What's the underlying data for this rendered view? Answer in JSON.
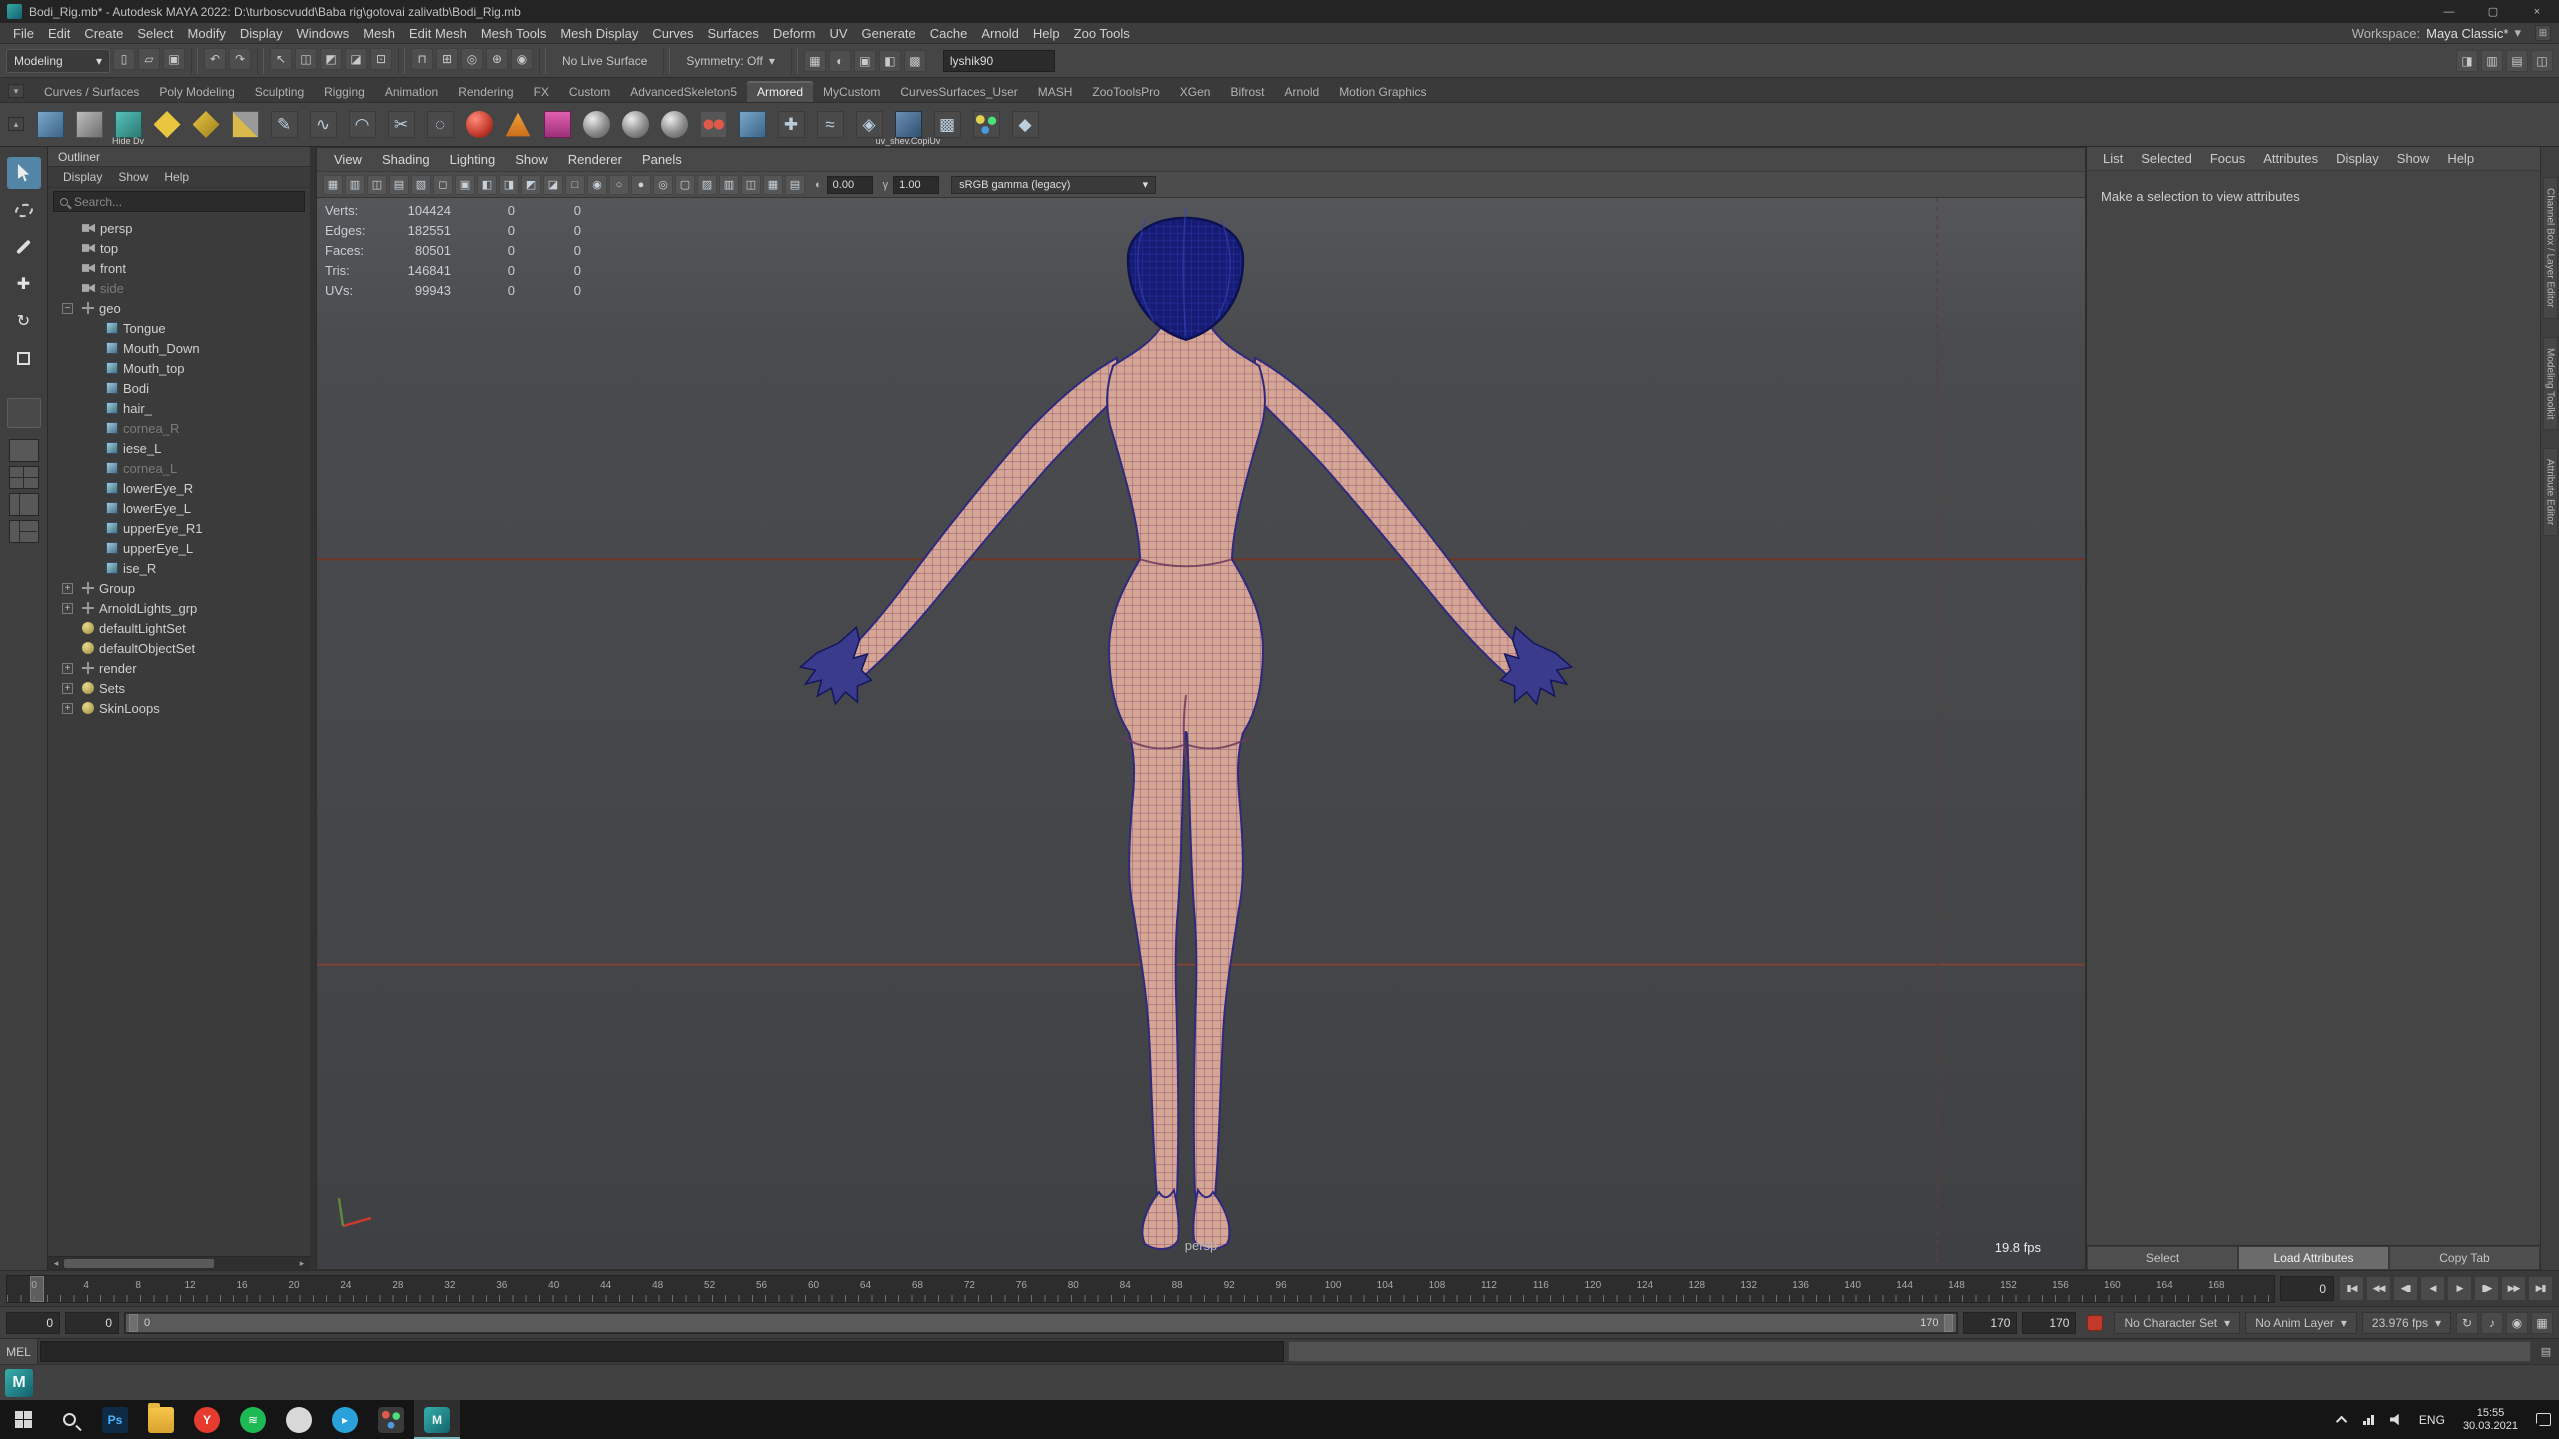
{
  "title_bar": {
    "title": "Bodi_Rig.mb* - Autodesk MAYA 2022: D:\\turboscvudd\\Baba rig\\gotovai zalivatb\\Bodi_Rig.mb",
    "minimize_glyph": "—",
    "restore_glyph": "▢",
    "close_glyph": "×"
  },
  "menu_bar": {
    "menus": [
      "File",
      "Edit",
      "Create",
      "Select",
      "Modify",
      "Display",
      "Windows",
      "Mesh",
      "Edit Mesh",
      "Mesh Tools",
      "Mesh Display",
      "Curves",
      "Surfaces",
      "Deform",
      "UV",
      "Generate",
      "Cache",
      "Arnold",
      "Help",
      "Zoo Tools"
    ],
    "workspace_label": "Workspace:",
    "workspace_value": "Maya Classic*",
    "workspace_arrow": "▾"
  },
  "status_line": {
    "mode": "Modeling",
    "mode_arrow": "▾",
    "items": [
      {
        "g": "▯"
      },
      {
        "g": "▱"
      },
      {
        "g": "▣"
      },
      {
        "cls": "divider"
      },
      {
        "g": "↶"
      },
      {
        "g": "↷"
      },
      {
        "cls": "divider"
      },
      {
        "g": "↖"
      },
      {
        "g": "◫"
      },
      {
        "g": "◩"
      },
      {
        "g": "◪"
      },
      {
        "g": "⊡"
      },
      {
        "cls": "divider"
      },
      {
        "g": "⊓"
      },
      {
        "g": "⊞"
      },
      {
        "g": "◎"
      },
      {
        "g": "⊕"
      },
      {
        "g": "◉"
      },
      {
        "cls": "divider"
      }
    ],
    "no_live_surface": "No Live Surface",
    "symmetry": "Symmetry: Off",
    "symmetry_arrow": "▾",
    "render_items": [
      {
        "g": "▦"
      },
      {
        "g": "◐"
      },
      {
        "g": "▣"
      },
      {
        "g": "◧"
      },
      {
        "g": "▩"
      }
    ],
    "input_value": "lyshik90",
    "right_items": [
      {
        "g": "◨"
      },
      {
        "g": "▥"
      },
      {
        "g": "▤"
      },
      {
        "g": "◫"
      }
    ]
  },
  "shelf_tabs": {
    "menu_glyph": "▾",
    "tabs": [
      {
        "label": "Curves / Surfaces"
      },
      {
        "label": "Poly Modeling"
      },
      {
        "label": "Sculpting"
      },
      {
        "label": "Rigging"
      },
      {
        "label": "Animation"
      },
      {
        "label": "Rendering"
      },
      {
        "label": "FX"
      },
      {
        "label": "Custom"
      },
      {
        "label": "AdvancedSkeleton5"
      },
      {
        "label": "Armored",
        "cls": "active"
      },
      {
        "label": "MyCustom"
      },
      {
        "label": "CurvesSurfaces_User"
      },
      {
        "label": "MASH"
      },
      {
        "label": "ZooToolsPro"
      },
      {
        "label": "XGen"
      },
      {
        "label": "Bifrost"
      },
      {
        "label": "Arnold"
      },
      {
        "label": "Motion Graphics"
      }
    ]
  },
  "shelf": {
    "menu_glyph": "▴",
    "items": [
      {
        "cls": "sh-cube-blue"
      },
      {
        "cls": "sh-cube-gray"
      },
      {
        "cls": "sh-cube-teal",
        "label": "Hide Dv"
      },
      {
        "cls": "sh-diamond"
      },
      {
        "cls": "sh-diamond2"
      },
      {
        "cls": "sh-cubes"
      },
      {
        "cls": "sh-glyph",
        "glyph": "✎"
      },
      {
        "cls": "sh-glyph",
        "glyph": "∿"
      },
      {
        "cls": "sh-glyph",
        "glyph": "◠"
      },
      {
        "cls": "sh-glyph",
        "glyph": "✂"
      },
      {
        "cls": "sh-glyph",
        "glyph": "◌"
      },
      {
        "cls": "sh-sphere-red"
      },
      {
        "cls": "sh-tri-orange"
      },
      {
        "cls": "sh-sq-magenta"
      },
      {
        "cls": "sh-sphere"
      },
      {
        "cls": "sh-sphere"
      },
      {
        "cls": "sh-sphere"
      },
      {
        "cls": "sh-dots-red"
      },
      {
        "cls": "sh-cube-blue"
      },
      {
        "cls": "sh-glyph",
        "glyph": "✚"
      },
      {
        "cls": "sh-glyph",
        "glyph": "≈"
      },
      {
        "cls": "sh-glyph",
        "glyph": "◈"
      },
      {
        "cls": "sh-uv",
        "label": "uv_shev.CopiUv"
      },
      {
        "cls": "sh-glyph",
        "glyph": "▩"
      },
      {
        "cls": "sh-dots-multi"
      },
      {
        "cls": "sh-glyph",
        "glyph": "◆"
      }
    ]
  },
  "toolbox": {
    "tools": [
      {
        "name": "select-tool",
        "cls": "tb-select selected"
      },
      {
        "name": "lasso-tool",
        "cls": "tb-lasso"
      },
      {
        "name": "paint-selection-tool",
        "cls": "tb-paint"
      },
      {
        "name": "move-tool",
        "cls": "tb-move",
        "glyph": "✚"
      },
      {
        "name": "rotate-tool",
        "cls": "tb-rotate",
        "glyph": "↻"
      },
      {
        "name": "scale-tool",
        "cls": "tb-scale"
      }
    ],
    "layouts": [
      {
        "name": "layout-single-pane",
        "cls": "lay-single"
      },
      {
        "name": "layout-four-pane",
        "cls": "lay-four"
      },
      {
        "name": "layout-two-pane",
        "cls": "lay-split2"
      },
      {
        "name": "layout-persp-outliner",
        "cls": "lay-split3"
      }
    ]
  },
  "outliner": {
    "title": "Outliner",
    "menus": [
      "Display",
      "Show",
      "Help"
    ],
    "search_placeholder": "Search...",
    "items": [
      {
        "label": "persp",
        "icon": "camera"
      },
      {
        "label": "top",
        "icon": "camera"
      },
      {
        "label": "front",
        "icon": "camera"
      },
      {
        "label": "side",
        "icon": "camera",
        "cls": "dimmed"
      },
      {
        "label": "geo",
        "icon": "transform",
        "expand": "−"
      },
      {
        "label": "Tongue",
        "icon": "mesh",
        "cls": "ind"
      },
      {
        "label": "Mouth_Down",
        "icon": "mesh",
        "cls": "ind"
      },
      {
        "label": "Mouth_top",
        "icon": "mesh",
        "cls": "ind"
      },
      {
        "label": "Bodi",
        "icon": "mesh",
        "cls": "ind"
      },
      {
        "label": "hair_",
        "icon": "mesh",
        "cls": "ind"
      },
      {
        "label": "cornea_R",
        "icon": "mesh",
        "cls": "ind dimmed"
      },
      {
        "label": "iese_L",
        "icon": "mesh",
        "cls": "ind"
      },
      {
        "label": "cornea_L",
        "icon": "mesh",
        "cls": "ind dimmed"
      },
      {
        "label": "lowerEye_R",
        "icon": "mesh",
        "cls": "ind"
      },
      {
        "label": "lowerEye_L",
        "icon": "mesh",
        "cls": "ind"
      },
      {
        "label": "upperEye_R1",
        "icon": "mesh",
        "cls": "ind"
      },
      {
        "label": "upperEye_L",
        "icon": "mesh",
        "cls": "ind"
      },
      {
        "label": "ise_R",
        "icon": "mesh",
        "cls": "ind"
      },
      {
        "label": "Group",
        "icon": "transform",
        "expand": "+"
      },
      {
        "label": "ArnoldLights_grp",
        "icon": "transform",
        "expand": "+"
      },
      {
        "label": "defaultLightSet",
        "icon": "set"
      },
      {
        "label": "defaultObjectSet",
        "icon": "set"
      },
      {
        "label": "render",
        "icon": "transform",
        "expand": "+"
      },
      {
        "label": "Sets",
        "icon": "set",
        "expand": "+"
      },
      {
        "label": "SkinLoops",
        "icon": "set",
        "expand": "+"
      }
    ]
  },
  "viewport": {
    "menus": [
      "View",
      "Shading",
      "Lighting",
      "Show",
      "Renderer",
      "Panels"
    ],
    "toolbar_items": [
      {
        "g": "▦"
      },
      {
        "g": "▥"
      },
      {
        "g": "◫"
      },
      {
        "g": "▤"
      },
      {
        "g": "▧"
      },
      {
        "g": "◻"
      },
      {
        "g": "▣"
      },
      {
        "g": "◧"
      },
      {
        "g": "◨"
      },
      {
        "g": "◩"
      },
      {
        "g": "◪"
      },
      {
        "g": "□"
      },
      {
        "g": "◉"
      },
      {
        "g": "○"
      },
      {
        "g": "●"
      },
      {
        "g": "◎"
      },
      {
        "g": "▢"
      },
      {
        "g": "▨"
      },
      {
        "g": "▥"
      },
      {
        "g": "◫"
      },
      {
        "g": "▦"
      },
      {
        "g": "▤"
      }
    ],
    "exposure_icon": "◐",
    "exposure": "0.00",
    "gamma_icon": "γ",
    "gamma": "1.00",
    "view_transform": "sRGB gamma (legacy)",
    "dropdown_arrow": "▾",
    "hud": [
      {
        "label": "Verts:",
        "value": "104424",
        "a": "0",
        "b": "0"
      },
      {
        "label": "Edges:",
        "value": "182551",
        "a": "0",
        "b": "0"
      },
      {
        "label": "Faces:",
        "value": "80501",
        "a": "0",
        "b": "0"
      },
      {
        "label": "Tris:",
        "value": "146841",
        "a": "0",
        "b": "0"
      },
      {
        "label": "UVs:",
        "value": "99943",
        "a": "0",
        "b": "0"
      }
    ],
    "camera_label": "persp",
    "fps": "19.8 fps"
  },
  "attribute_editor": {
    "menus": [
      "List",
      "Selected",
      "Focus",
      "Attributes",
      "Display",
      "Show",
      "Help"
    ],
    "message": "Make a selection to view attributes",
    "buttons": [
      {
        "label": "Select"
      },
      {
        "label": "Load Attributes",
        "cls": "primary"
      },
      {
        "label": "Copy Tab"
      }
    ]
  },
  "right_strip": {
    "tabs": [
      "Channel Box / Layer Editor",
      "Modeling Toolkit",
      "Attribute Editor"
    ]
  },
  "timeline": {
    "start": 0,
    "end": 170,
    "label_step": 4,
    "current_frame": 0,
    "current_time": "0",
    "playback": [
      {
        "g": "▮◀",
        "name": "go-to-start-button"
      },
      {
        "g": "◀◀",
        "name": "step-back-frame-button"
      },
      {
        "g": "◀▮",
        "name": "step-back-key-button"
      },
      {
        "g": "◀",
        "name": "play-backwards-button"
      },
      {
        "g": "▶",
        "name": "play-forward-button"
      },
      {
        "g": "▮▶",
        "name": "step-forward-key-button"
      },
      {
        "g": "▶▶",
        "name": "step-forward-frame-button"
      },
      {
        "g": "▶▮",
        "name": "go-to-end-button"
      }
    ]
  },
  "range_slider": {
    "anim_start": "0",
    "playback_start": "0",
    "bar_start_label": "0",
    "bar_end_label": "170",
    "playback_end": "170",
    "anim_end": "170",
    "character_set": "No Character Set",
    "anim_layer": "No Anim Layer",
    "fps": "23.976 fps",
    "dd_arrow": "▾",
    "right_items": [
      {
        "g": "↻"
      },
      {
        "g": "♪"
      },
      {
        "g": "◉"
      },
      {
        "g": "▦"
      }
    ]
  },
  "command_line": {
    "label": "MEL",
    "input_value": "",
    "result_value": ""
  },
  "help_line": {
    "text": "",
    "logo_letter": "M"
  },
  "taskbar": {
    "apps": [
      {
        "cls": "app-ps",
        "text": "Ps",
        "name": "photoshop-icon"
      },
      {
        "cls": "app-folder",
        "name": "file-explorer-icon"
      },
      {
        "cls": "app-browser",
        "text": "Y",
        "name": "browser-icon"
      },
      {
        "cls": "app-spotify",
        "text": "≋",
        "name": "spotify-icon"
      },
      {
        "cls": "app-gray",
        "name": "app-icon"
      },
      {
        "cls": "app-blue",
        "text": "▸",
        "name": "messenger-icon"
      },
      {
        "cls": "app-dark",
        "name": "app-icon"
      },
      {
        "cls": "app-maya",
        "wrap_cls": "active",
        "text": "M",
        "name": "maya-icon"
      }
    ],
    "lang": "ENG",
    "time": "15:55",
    "date": "30.03.2021"
  }
}
